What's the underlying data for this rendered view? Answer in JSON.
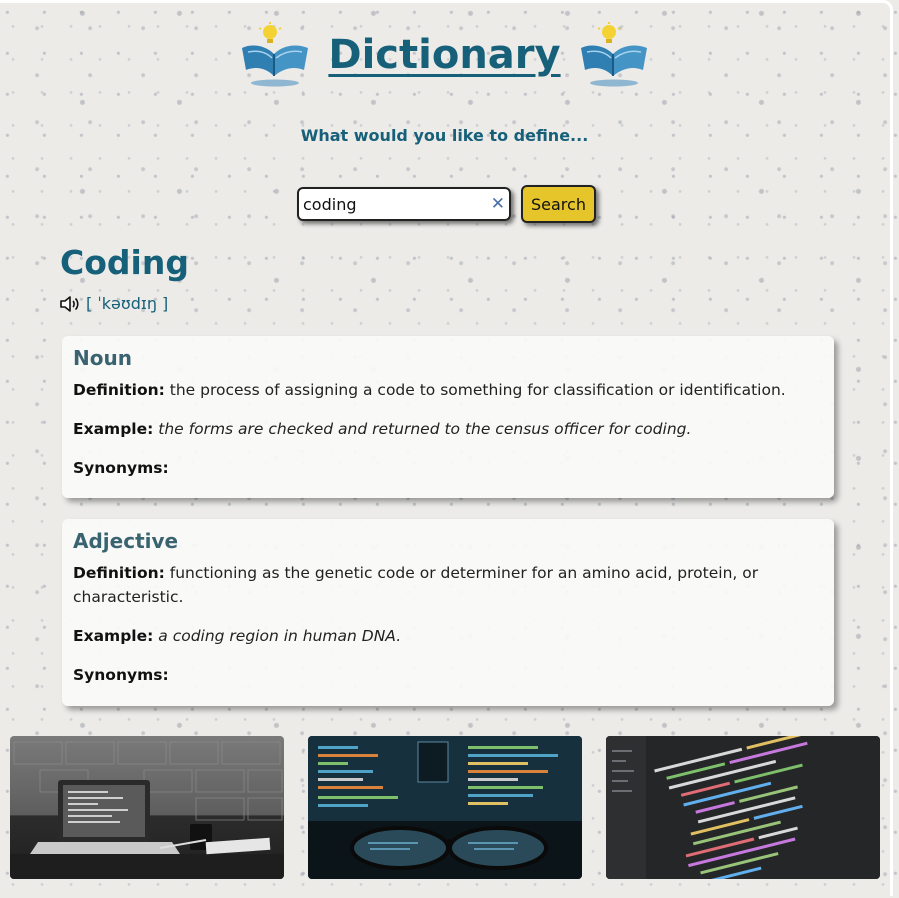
{
  "header": {
    "title": "Dictionary",
    "left_icon": "book-lightbulb-icon",
    "right_icon": "book-lightbulb-icon",
    "title_color": "#17607a"
  },
  "prompt": "What would you like to define...",
  "search": {
    "value": "coding",
    "clear_icon": "close-icon",
    "button_label": "Search",
    "button_color": "#e6c52a"
  },
  "result": {
    "word": "Coding",
    "phonetic": "[ ˈkəʊdɪŋ ]",
    "audio_icon": "speaker-icon",
    "meanings": [
      {
        "part_of_speech": "Noun",
        "definition_label": "Definition:",
        "definition": "the process of assigning a code to something for classification or identification.",
        "example_label": "Example:",
        "example": "the forms are checked and returned to the census officer for coding.",
        "synonyms_label": "Synonyms:",
        "synonyms": ""
      },
      {
        "part_of_speech": "Adjective",
        "definition_label": "Definition:",
        "definition": "functioning as the genetic code or determiner for an amino acid, protein, or characteristic.",
        "example_label": "Example:",
        "example": "a coding region in human DNA.",
        "synonyms_label": "Synonyms:",
        "synonyms": ""
      }
    ]
  },
  "gallery": {
    "images": [
      {
        "subject": "laptop-on-desk-image"
      },
      {
        "subject": "glasses-in-front-of-monitor-image"
      },
      {
        "subject": "code-editor-screen-image"
      }
    ]
  }
}
